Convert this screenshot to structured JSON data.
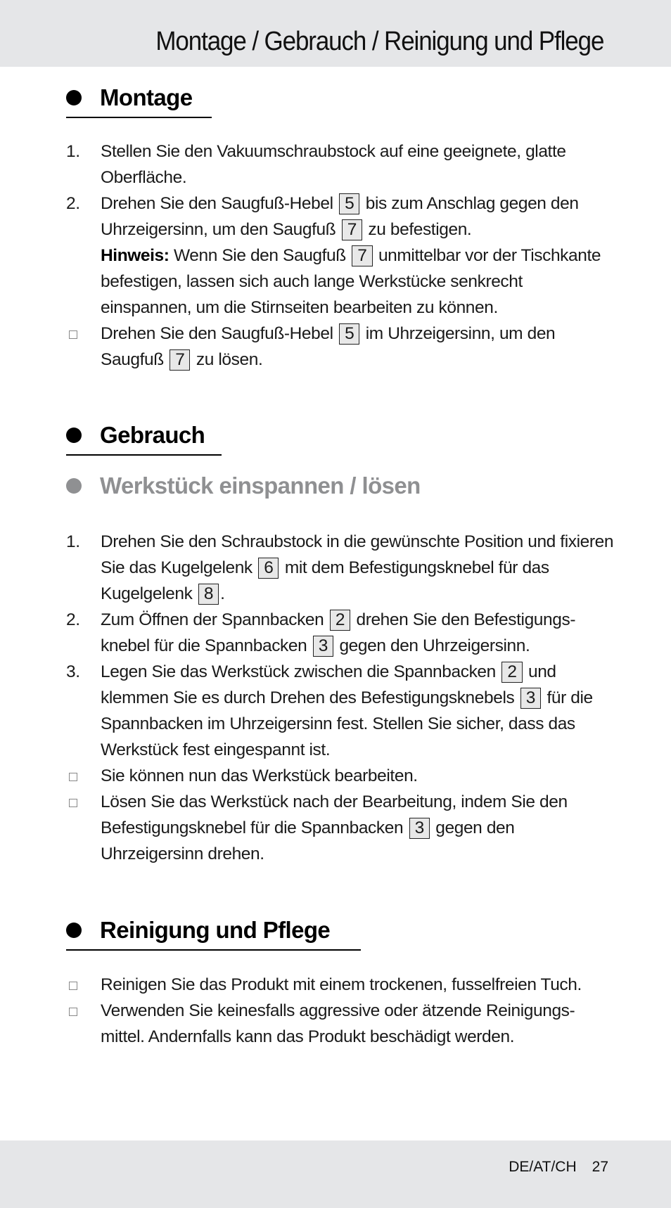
{
  "header": {
    "title": "Montage / Gebrauch / Reinigung und Pflege"
  },
  "sections": {
    "montage": {
      "heading": "Montage",
      "items": [
        {
          "marker": "1.",
          "parts": [
            "Stellen Sie den Vakuumschraubstock auf eine geeignete, glatte Oberfläche."
          ]
        },
        {
          "marker": "2.",
          "parts": [
            "Drehen Sie den Saugfuß-Hebel",
            "5",
            "bis zum Anschlag gegen den Uhrzeigersinn, um den Saugfuß",
            "7",
            "zu befestigen."
          ],
          "note_label": "Hinweis:",
          "note_parts": [
            "Wenn Sie den Saugfuß",
            "7",
            "unmittelbar vor der Tischkante befestigen, lassen sich auch lange Werkstücke senkrecht einspannen, um die Stirnseiten bearbeiten zu können."
          ]
        },
        {
          "marker": "square",
          "parts": [
            "Drehen Sie den Saugfuß-Hebel",
            "5",
            "im Uhrzeigersinn, um den Saugfuß",
            "7",
            "zu lösen."
          ]
        }
      ]
    },
    "gebrauch": {
      "heading": "Gebrauch",
      "subheading": "Werkstück einspannen / lösen",
      "items": [
        {
          "marker": "1.",
          "parts": [
            "Drehen Sie den Schraubstock in die gewünschte Position und fixieren Sie das Kugelgelenk",
            "6",
            "mit dem Befestigungsknebel für das Kugelgelenk",
            "8",
            "."
          ]
        },
        {
          "marker": "2.",
          "parts": [
            "Zum Öffnen der Spannbacken",
            "2",
            "drehen Sie den Befestigungs-knebel für die Spannbacken",
            "3",
            "gegen den Uhrzeigersinn."
          ]
        },
        {
          "marker": "3.",
          "parts": [
            "Legen Sie das Werkstück zwischen die Spannbacken",
            "2",
            "und klemmen Sie es durch Drehen des Befestigungsknebels",
            "3",
            "für die Spannbacken im Uhrzeigersinn fest. Stellen Sie sicher, dass das Werkstück fest eingespannt ist."
          ]
        },
        {
          "marker": "square",
          "parts": [
            "Sie können nun das Werkstück bearbeiten."
          ]
        },
        {
          "marker": "square",
          "parts": [
            "Lösen Sie das Werkstück nach der Bearbeitung, indem Sie den Befestigungsknebel für die Spannbacken",
            "3",
            "gegen den Uhrzeigersinn drehen."
          ]
        }
      ]
    },
    "reinigung": {
      "heading": "Reinigung und Pflege",
      "items": [
        {
          "marker": "square",
          "parts": [
            "Reinigen Sie das Produkt mit einem trockenen, fusselfreien Tuch."
          ]
        },
        {
          "marker": "square",
          "parts": [
            "Verwenden Sie keinesfalls aggressive oder ätzende Reinigungs-mittel. Andernfalls kann das Produkt beschädigt werden."
          ]
        }
      ]
    }
  },
  "footer": {
    "region": "DE/AT/CH",
    "page_number": "27"
  }
}
